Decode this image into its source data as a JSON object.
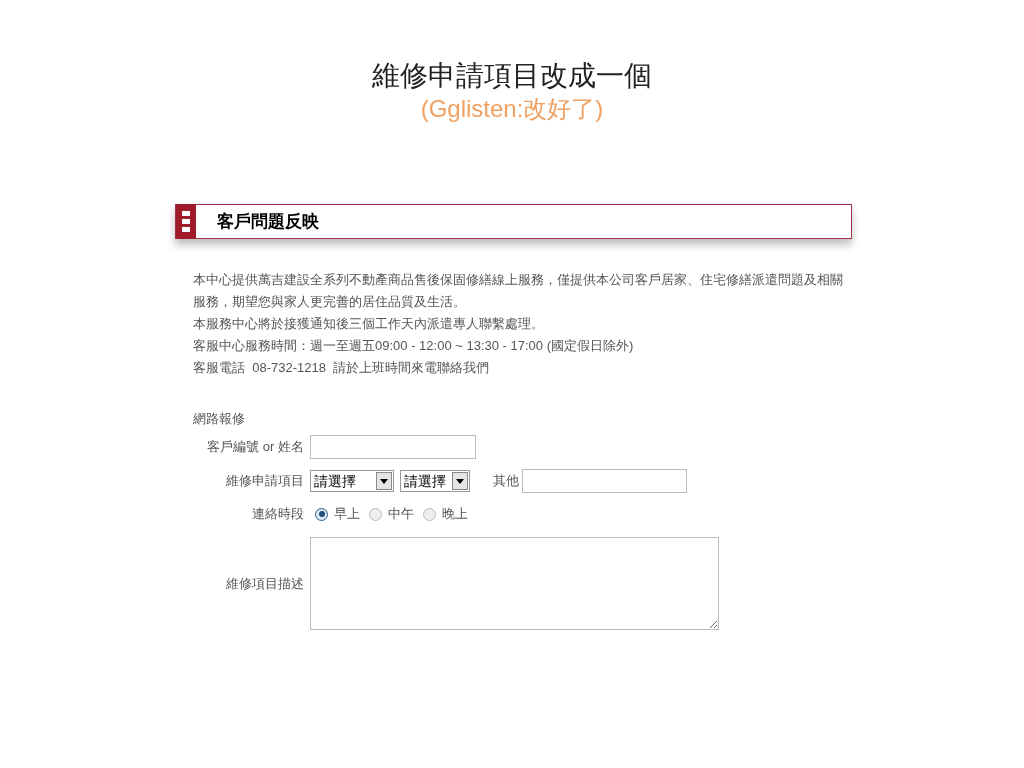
{
  "slide": {
    "title": "維修申請項目改成一個",
    "subtitle": "(Gglisten:改好了)"
  },
  "section_header": {
    "title": "客戶問題反映"
  },
  "intro": {
    "lines": [
      "本中心提供萬吉建設全系列不動產商品售後保固修繕線上服務，僅提供本公司客戶居家、住宅修繕派遣問題及相關服務，期望您與家人更完善的居住品質及生活。",
      "本服務中心將於接獲通知後三個工作天內派遣專人聯繫處理。",
      "客服中心服務時間：週一至週五09:00 - 12:00 ~ 13:30 - 17:00 (國定假日除外)",
      "客服電話  08-732-1218  請於上班時間來電聯絡我們"
    ]
  },
  "form": {
    "heading": "網路報修",
    "fields": [
      {
        "kind": "text",
        "label": "客戶編號 or 姓名"
      },
      {
        "kind": "selects",
        "label": "維修申請項目",
        "selects": [
          {
            "value": "請選擇"
          },
          {
            "value": "請選擇"
          }
        ],
        "other_label": "其他"
      },
      {
        "kind": "radio",
        "label": "連絡時段",
        "options": [
          {
            "label": "早上",
            "selected": true
          },
          {
            "label": "中午",
            "selected": false
          },
          {
            "label": "晚上",
            "selected": false
          }
        ]
      },
      {
        "kind": "textarea",
        "label": "維修項目描述"
      }
    ]
  }
}
